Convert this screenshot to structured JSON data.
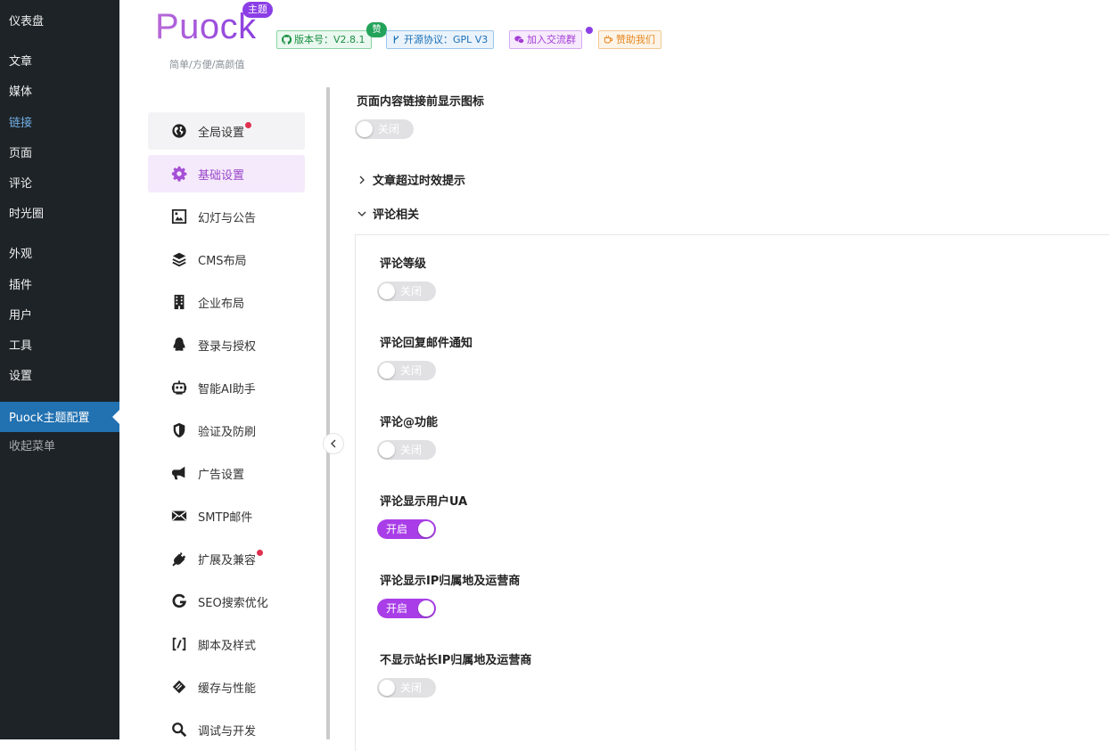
{
  "wp_menu": {
    "items": [
      {
        "label": "仪表盘"
      },
      {
        "label": "文章"
      },
      {
        "label": "媒体"
      },
      {
        "label": "链接"
      },
      {
        "label": "页面"
      },
      {
        "label": "评论"
      },
      {
        "label": "时光圈"
      },
      {
        "label": "外观"
      },
      {
        "label": "插件"
      },
      {
        "label": "用户"
      },
      {
        "label": "工具"
      },
      {
        "label": "设置"
      }
    ],
    "current": "Puock主题配置",
    "collapse": "收起菜单"
  },
  "header": {
    "logo": "Puock",
    "theme_badge": "主题",
    "tagline": "简单/方便/高颜值",
    "version": "版本号：V2.8.1",
    "zan_badge": "赞",
    "license": "开源协议：GPL V3",
    "group": "加入交流群",
    "donate": "赞助我们"
  },
  "settings_nav": {
    "items": [
      {
        "label": "全局设置",
        "icon": "globe-icon",
        "dot": true
      },
      {
        "label": "基础设置",
        "icon": "gear-icon",
        "active": true
      },
      {
        "label": "幻灯与公告",
        "icon": "slideshow-icon"
      },
      {
        "label": "CMS布局",
        "icon": "layers-icon"
      },
      {
        "label": "企业布局",
        "icon": "building-icon"
      },
      {
        "label": "登录与授权",
        "icon": "qq-icon"
      },
      {
        "label": "智能AI助手",
        "icon": "robot-icon"
      },
      {
        "label": "验证及防刷",
        "icon": "shield-icon"
      },
      {
        "label": "广告设置",
        "icon": "bullhorn-icon"
      },
      {
        "label": "SMTP邮件",
        "icon": "envelope-icon"
      },
      {
        "label": "扩展及兼容",
        "icon": "plug-icon",
        "dot": true
      },
      {
        "label": "SEO搜索优化",
        "icon": "google-icon"
      },
      {
        "label": "脚本及样式",
        "icon": "code-icon"
      },
      {
        "label": "缓存与性能",
        "icon": "cache-icon"
      },
      {
        "label": "调试与开发",
        "icon": "search-debug-icon"
      }
    ]
  },
  "main": {
    "link_icon_title": "页面内容链接前显示图标",
    "link_icon_switch": "关闭",
    "section_expiry": "文章超过时效提示",
    "section_comments": "评论相关",
    "fields": [
      {
        "title": "评论等级",
        "switch": "关闭",
        "on": false
      },
      {
        "title": "评论回复邮件通知",
        "switch": "关闭",
        "on": false
      },
      {
        "title": "评论@功能",
        "switch": "关闭",
        "on": false
      },
      {
        "title": "评论显示用户UA",
        "switch": "开启",
        "on": true
      },
      {
        "title": "评论显示IP归属地及运营商",
        "switch": "开启",
        "on": true
      },
      {
        "title": "不显示站长IP归属地及运营商",
        "switch": "关闭",
        "on": false
      }
    ]
  },
  "colors": {
    "accent": "#a93ee8",
    "wp_sidebar": "#1d2327",
    "wp_current": "#2271b1"
  }
}
